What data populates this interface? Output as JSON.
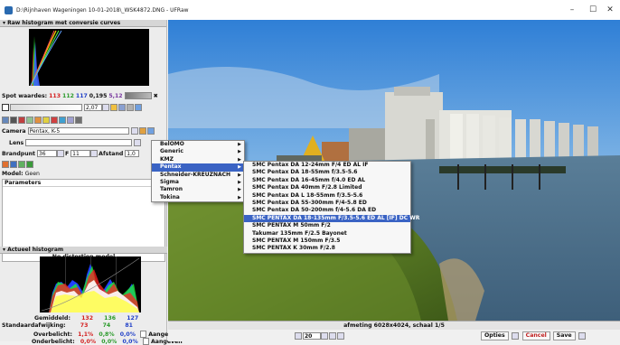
{
  "window": {
    "title": "D:\\Rijnhaven Wageningen 10-01-2018\\_WSK4872.DNG - UFRaw",
    "minimize": "–",
    "maximize": "☐",
    "close": "✕"
  },
  "raw_histogram": {
    "header": "Raw histogram met conversie curves",
    "spot_label": "Spot waardes:",
    "spot_r": "113",
    "spot_g": "112",
    "spot_b": "117",
    "spot_v1": "0,195",
    "spot_v2": "5,12",
    "exposure_value": "2,07"
  },
  "lens": {
    "camera_label": "Camera",
    "camera_value": "Pentax, K-5",
    "lens_label": "Lens",
    "lens_value": "",
    "focal_label": "Brandpunt",
    "focal_value": "36",
    "f_label": "F",
    "f_value": "11",
    "distance_label": "Afstand",
    "distance_value": "1,0",
    "model_label": "Model:",
    "model_value": "Geen",
    "params_label": "Parameters",
    "no_distortion": "No distortion model"
  },
  "actual_histogram": {
    "header": "Actueel histogram",
    "avg_label": "Gemiddeld:",
    "avg_r": "132",
    "avg_g": "136",
    "avg_b": "127",
    "std_label": "Standaardafwijking:",
    "std_r": "73",
    "std_g": "74",
    "std_b": "81",
    "over_label": "Overbelicht:",
    "over_r": "1,1%",
    "over_g": "0,8%",
    "over_b": "0,0%",
    "show_label": "Aangeven",
    "under_label": "Onderbelicht:",
    "under_r": "0,0%",
    "under_g": "0,0%",
    "under_b": "0,0%",
    "show_label2": "Aangeven"
  },
  "status": {
    "text": "afmeting 6028x4024, schaal 1/5"
  },
  "bottombar": {
    "zoom_value": "20",
    "options_label": "Opties",
    "cancel_label": "Cancel",
    "save_label": "Save"
  },
  "maker_menu": [
    "BelOMO",
    "Generic",
    "KMZ",
    "Pentax",
    "Schneider-KREUZNACH",
    "Sigma",
    "Tamron",
    "Tokina"
  ],
  "lens_menu": [
    "SMC Pentax DA 12-24mm F/4 ED AL IF",
    "SMC Pentax DA 18-55mm f/3.5-5.6",
    "SMC Pentax DA 16-45mm f/4.0 ED AL",
    "SMC Pentax DA 40mm F/2.8 Limited",
    "SMC Pentax DA L 18-55mm f/3.5-5.6",
    "SMC Pentax DA 55-300mm F/4-5.8 ED",
    "SMC Pentax DA 50-200mm f/4-5.6 DA ED",
    "SMC PENTAX DA 18-135mm F/3.5-5.6 ED AL [IF] DC WR",
    "SMC PENTAX M 50mm F/2",
    "Takumar 135mm F/2.5 Bayonet",
    "SMC PENTAX M 150mm F/3.5",
    "SMC PENTAX K 30mm F/2.8"
  ],
  "colors": {
    "menu_highlight": "#3a63c4",
    "red": "#d42020",
    "green": "#2a9a2a",
    "blue": "#2040c8"
  }
}
